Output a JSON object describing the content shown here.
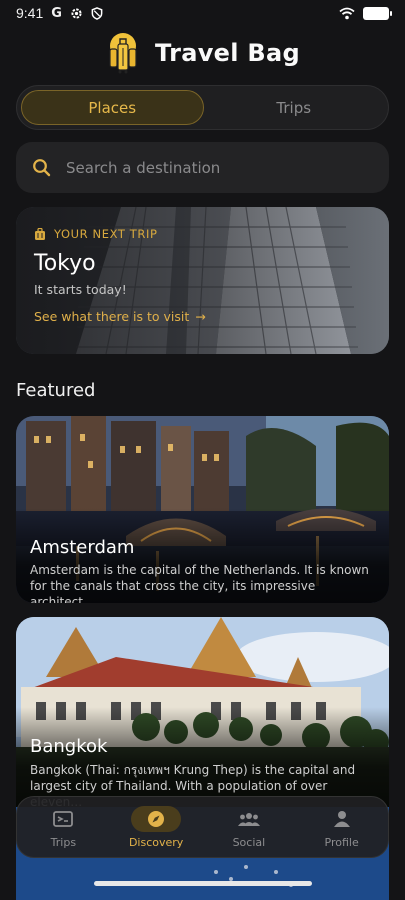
{
  "status_bar": {
    "time": "9:41",
    "icons": [
      "google-g-icon",
      "gear-icon",
      "shield-icon",
      "wifi-icon",
      "battery-icon"
    ],
    "g_glyph": "G"
  },
  "header": {
    "title": "Travel Bag",
    "logo": "travel-bag-logo"
  },
  "tabs": [
    {
      "label": "Places",
      "active": true
    },
    {
      "label": "Trips",
      "active": false
    }
  ],
  "search": {
    "placeholder": "Search a destination",
    "value": ""
  },
  "next_trip": {
    "kicker": "YOUR NEXT TRIP",
    "city": "Tokyo",
    "subtitle": "It starts today!",
    "link": "See what there is to visit",
    "link_arrow": "→"
  },
  "featured": {
    "title": "Featured",
    "items": [
      {
        "name": "Amsterdam",
        "description": "Amsterdam is the capital of the Netherlands. It is known for the canals that cross the city, its impressive architect…"
      },
      {
        "name": "Bangkok",
        "description": "Bangkok (Thai: กรุงเทพฯ Krung Thep) is the capital and largest city of Thailand. With a population of over eleven…"
      }
    ]
  },
  "bottom_nav": [
    {
      "label": "Trips",
      "icon": "ticket-icon",
      "active": false
    },
    {
      "label": "Discovery",
      "icon": "compass-icon",
      "active": true
    },
    {
      "label": "Social",
      "icon": "people-icon",
      "active": false
    },
    {
      "label": "Profile",
      "icon": "person-icon",
      "active": false
    }
  ],
  "colors": {
    "accent": "#e3b34a",
    "background": "#141416",
    "card": "#232325"
  }
}
